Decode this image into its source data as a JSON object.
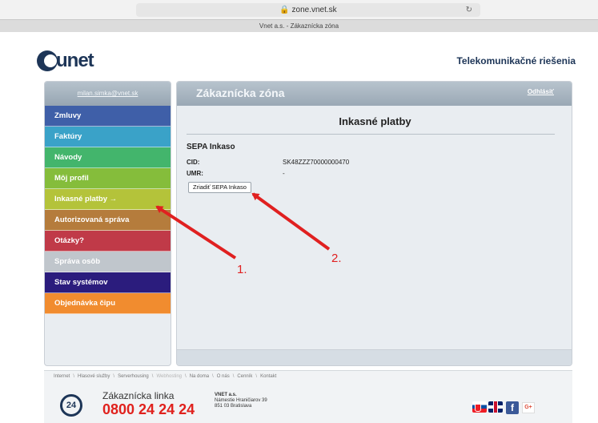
{
  "browser": {
    "url": "zone.vnet.sk",
    "lock_icon": "lock-icon",
    "tab_title": "Vnet a.s. - Zákaznícka zóna"
  },
  "header": {
    "logo_text": "unet",
    "tagline": "Telekomunikačné riešenia"
  },
  "sidebar": {
    "user": "milan.simka@vnet.sk",
    "items": [
      {
        "label": "Zmluvy",
        "color": "#3f5fa8"
      },
      {
        "label": "Faktúry",
        "color": "#3aa2c8"
      },
      {
        "label": "Návody",
        "color": "#43b56c"
      },
      {
        "label": "Môj profil",
        "color": "#85bd3b"
      },
      {
        "label": "Inkasné platby →",
        "color": "#b4c33a"
      },
      {
        "label": "Autorizovaná správa",
        "color": "#b57c3c"
      },
      {
        "label": "Otázky?",
        "color": "#c03a48"
      },
      {
        "label": "Správa osôb",
        "color": "#c0c6cc"
      },
      {
        "label": "Stav systémov",
        "color": "#2b1c7d"
      },
      {
        "label": "Objednávka čipu",
        "color": "#f18c2f"
      }
    ]
  },
  "panel": {
    "title": "Zákaznícka zóna",
    "logout": "Odhlásiť",
    "page_title": "Inkasné platby",
    "section_title": "SEPA Inkaso",
    "cid_label": "CID:",
    "cid_value": "SK48ZZZ70000000470",
    "umr_label": "UMR:",
    "umr_value": "-",
    "button": "Zriadiť SEPA Inkaso"
  },
  "annotations": {
    "callout_1": "1.",
    "callout_2": "2.",
    "arrow_color": "#e02020"
  },
  "footer": {
    "links": [
      "Internet",
      "Hlasové služby",
      "Serverhousing",
      "Webhosting",
      "Na doma",
      "O nás",
      "Cenník",
      "Kontakt"
    ],
    "hotline_label": "Zákaznícka linka",
    "hotline_badge": "24",
    "hotline_number": "0800 24 24 24",
    "company_name": "VNET a.s.",
    "company_street": "Námestie Hraničiarov 39",
    "company_city": "851 03 Bratislava",
    "facebook_glyph": "f",
    "gplus_glyph": "G+"
  }
}
